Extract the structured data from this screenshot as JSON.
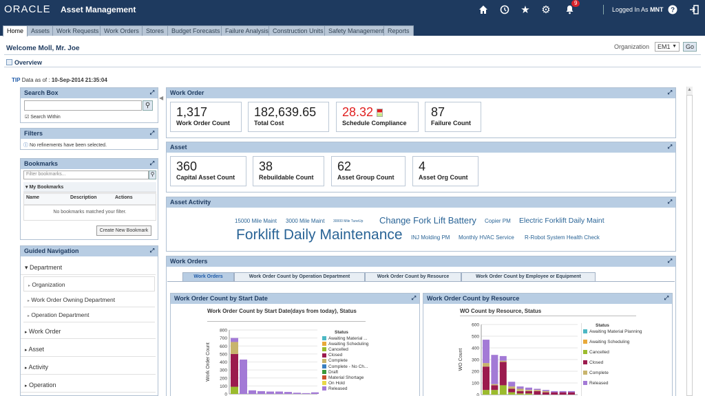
{
  "header": {
    "logo": "ORACLE",
    "app_name": "Asset Management",
    "notification_count": "9",
    "logged_in_prefix": "Logged In As",
    "user": "MNT"
  },
  "tabs": [
    "Home",
    "Assets",
    "Work Requests",
    "Work Orders",
    "Stores",
    "Budget Forecasts",
    "Failure Analysis",
    "Construction Units",
    "Safety Management",
    "Reports"
  ],
  "page": {
    "welcome": "Welcome Moll, Mr. Joe",
    "org_label": "Organization",
    "org_value": "EM1",
    "go_label": "Go",
    "overview": "Overview",
    "tip_label": "TIP",
    "data_as_of_prefix": "Data as of :",
    "data_as_of": "10-Sep-2014 21:35:04"
  },
  "search_box": {
    "title": "Search Box",
    "search_within": "Search Within"
  },
  "filters": {
    "title": "Filters",
    "message": "No refinements have been selected."
  },
  "bookmarks": {
    "title": "Bookmarks",
    "placeholder": "Filter bookmarks...",
    "my_bookmarks": "My Bookmarks",
    "columns": [
      "Name",
      "Description",
      "Actions"
    ],
    "empty": "No bookmarks matched your filter.",
    "new_button": "Create New Bookmark"
  },
  "guided_nav": {
    "title": "Guided Navigation",
    "items": [
      "Department",
      "Organization",
      "Work Order Owning Department",
      "Operation Department",
      "Work Order",
      "Asset",
      "Activity",
      "Operation"
    ]
  },
  "work_order": {
    "title": "Work Order",
    "kpis": [
      {
        "value": "1,317",
        "label": "Work Order Count"
      },
      {
        "value": "182,639.65",
        "label": "Total Cost"
      },
      {
        "value": "28.32",
        "label": "Schedule Compliance"
      },
      {
        "value": "87",
        "label": "Failure Count"
      }
    ]
  },
  "asset": {
    "title": "Asset",
    "kpis": [
      {
        "value": "360",
        "label": "Capital Asset Count"
      },
      {
        "value": "38",
        "label": "Rebuildable Count"
      },
      {
        "value": "62",
        "label": "Asset Group Count"
      },
      {
        "value": "4",
        "label": "Asset Org Count"
      }
    ]
  },
  "asset_activity": {
    "title": "Asset Activity",
    "tags": [
      "15000 Mile Maint",
      "3000 Mile Maint",
      "30000 Mile TuneUp",
      "Change Fork Lift Battery",
      "Copier PM",
      "Electric Forklift Daily Maint",
      "Forklift Daily Maintenance",
      "INJ Molding PM",
      "Monthly HVAC Service",
      "R-Robot System Health Check"
    ]
  },
  "work_orders": {
    "title": "Work Orders",
    "tabs": [
      "Work Orders",
      "Work Order Count by Operation Department",
      "Work Order Count by Resource",
      "Work Order Count by Employee or Equipment"
    ],
    "chart1_panel": "Work Order Count by Start Date",
    "chart2_panel": "Work Order Count by Resource"
  },
  "colors": {
    "awaiting_material": "#4cb8c4",
    "awaiting_scheduling": "#e8a93a",
    "cancelled": "#9bbb2d",
    "closed": "#9b1b4e",
    "complete": "#c8b46c",
    "complete_no_charges": "#3a7fc1",
    "draft": "#3a9a3a",
    "material_shortage": "#c8502a",
    "on_hold": "#e8d84a",
    "released": "#a37ad6"
  },
  "chart_data": [
    {
      "type": "bar",
      "title": "Work Order Count by Start Date(days from today), Status",
      "ylabel": "Work Order Count",
      "ylim": [
        0,
        800
      ],
      "yticks": [
        0,
        100,
        200,
        300,
        400,
        500,
        600,
        700,
        800
      ],
      "legend_title": "Status",
      "series": [
        {
          "name": "Awaiting Material ...",
          "values": [
            0,
            0,
            0,
            0,
            0,
            0,
            0,
            0,
            0,
            0
          ]
        },
        {
          "name": "Awaiting Scheduling",
          "values": [
            0,
            0,
            0,
            0,
            0,
            0,
            0,
            0,
            0,
            0
          ]
        },
        {
          "name": "Cancelled",
          "values": [
            90,
            0,
            0,
            0,
            0,
            0,
            0,
            0,
            0,
            0
          ]
        },
        {
          "name": "Closed",
          "values": [
            410,
            0,
            0,
            0,
            0,
            0,
            0,
            0,
            0,
            0
          ]
        },
        {
          "name": "Complete",
          "values": [
            150,
            0,
            0,
            0,
            0,
            0,
            0,
            0,
            0,
            0
          ]
        },
        {
          "name": "Complete - No Ch...",
          "values": [
            0,
            0,
            0,
            0,
            0,
            0,
            0,
            0,
            0,
            0
          ]
        },
        {
          "name": "Draft",
          "values": [
            0,
            0,
            0,
            0,
            0,
            0,
            0,
            0,
            0,
            0
          ]
        },
        {
          "name": "Material Shortage",
          "values": [
            0,
            0,
            0,
            0,
            0,
            0,
            0,
            0,
            0,
            0
          ]
        },
        {
          "name": "On Hold",
          "values": [
            0,
            0,
            0,
            0,
            0,
            0,
            0,
            0,
            0,
            0
          ]
        },
        {
          "name": "Released",
          "values": [
            50,
            430,
            45,
            35,
            30,
            30,
            25,
            15,
            10,
            20
          ]
        }
      ]
    },
    {
      "type": "bar",
      "title": "WO Count by Resource, Status",
      "ylabel": "WO Count",
      "ylim": [
        0,
        600
      ],
      "yticks": [
        0,
        100,
        200,
        300,
        400,
        500,
        600
      ],
      "legend_title": "Status",
      "series": [
        {
          "name": "Awaiting Material Planning",
          "values": [
            0,
            0,
            0,
            0,
            0,
            0,
            0,
            0,
            0,
            0,
            0
          ]
        },
        {
          "name": "Awaiting Scheduling",
          "values": [
            0,
            0,
            0,
            0,
            0,
            0,
            0,
            0,
            0,
            0,
            0
          ]
        },
        {
          "name": "Cancelled",
          "values": [
            40,
            40,
            80,
            20,
            10,
            10,
            0,
            0,
            0,
            0,
            0
          ]
        },
        {
          "name": "Closed",
          "values": [
            200,
            40,
            200,
            30,
            20,
            20,
            30,
            20,
            20,
            20,
            20
          ]
        },
        {
          "name": "Complete",
          "values": [
            30,
            10,
            10,
            20,
            20,
            10,
            10,
            10,
            0,
            0,
            0
          ]
        },
        {
          "name": "Released",
          "values": [
            200,
            250,
            40,
            40,
            20,
            20,
            10,
            10,
            10,
            10,
            10
          ]
        }
      ]
    }
  ]
}
